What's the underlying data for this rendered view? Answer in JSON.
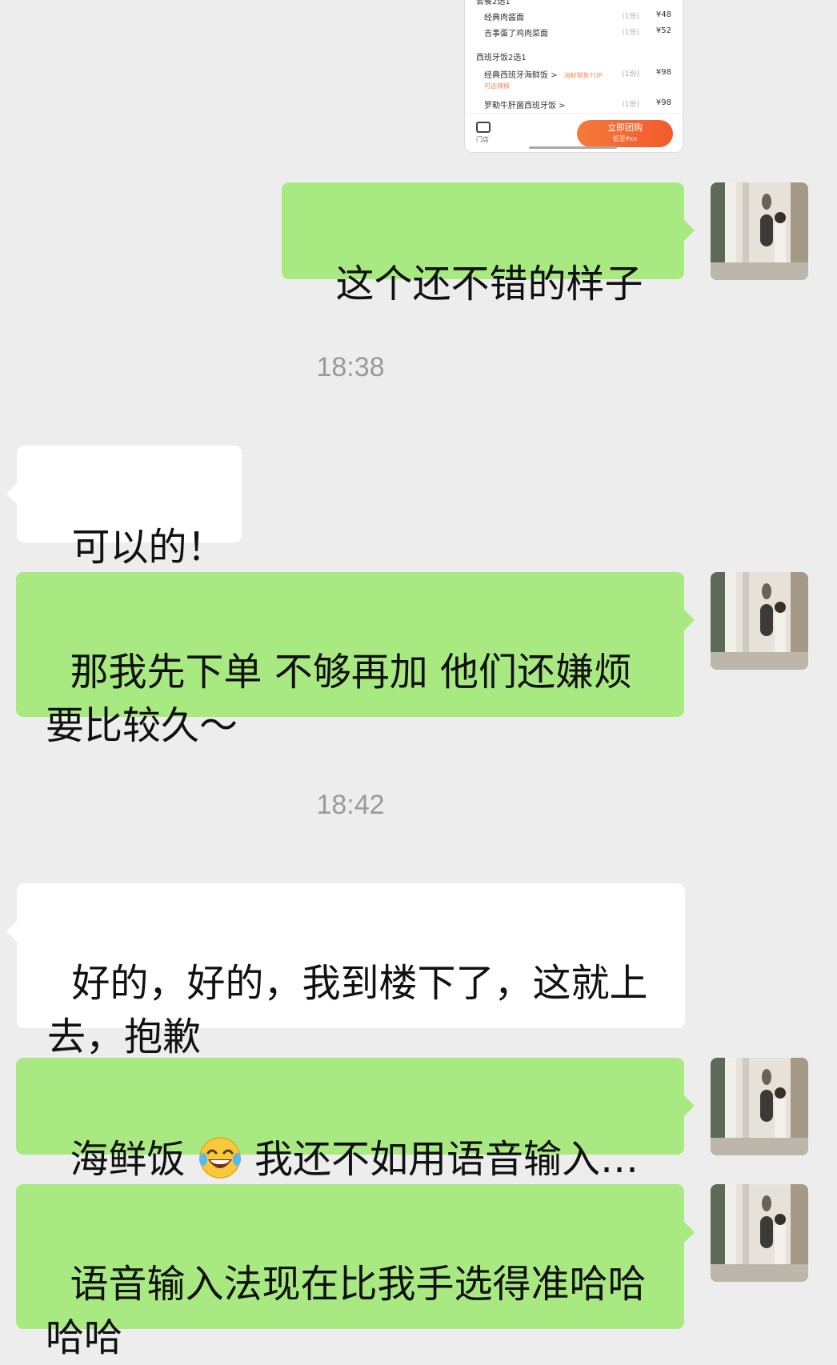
{
  "screenshot_card": {
    "group_top": "套餐2选1",
    "items_group1": [
      {
        "name": "经典肉酱面",
        "qty": "(1份)",
        "price": "¥48"
      },
      {
        "name": "吉事蛋了鸡肉菜面",
        "qty": "(1份)",
        "price": "¥52"
      }
    ],
    "group2": "西班牙饭2选1",
    "items_group2": [
      {
        "name": "经典西班牙海鲜饭 >",
        "tag": "海鲜销售TOP",
        "qty": "(1份)",
        "price": "¥98"
      },
      {
        "name": "罗勒牛肝菌西班牙饭 >",
        "qty": "(1份)",
        "price": "¥98"
      }
    ],
    "sub_note": "可选辣椒",
    "store_label": "门店",
    "buy_button": "立即团购",
    "buy_button_sub": "低至¥xx"
  },
  "messages": {
    "m1": "这个还不错的样子",
    "t1": "18:38",
    "m2": "可以的！",
    "m3": "那我先下单 不够再加 他们还嫌烦\n要比较久～",
    "t2": "18:42",
    "m4": "好的，好的，我到楼下了，这就上\n去，抱歉",
    "m5_before": "海鲜饭 ",
    "m5_after": " 我还不如用语音输入…",
    "m6": "语音输入法现在比我手选得准哈哈\n哈哈"
  },
  "colors": {
    "background": "#ededed",
    "my_bubble": "#a9e982",
    "their_bubble": "#ffffff",
    "time_text": "#9a9a9a",
    "buy_button": "#f35a2c"
  },
  "icons": {
    "emoji": "laughing-tears-emoji",
    "store": "store-icon"
  }
}
